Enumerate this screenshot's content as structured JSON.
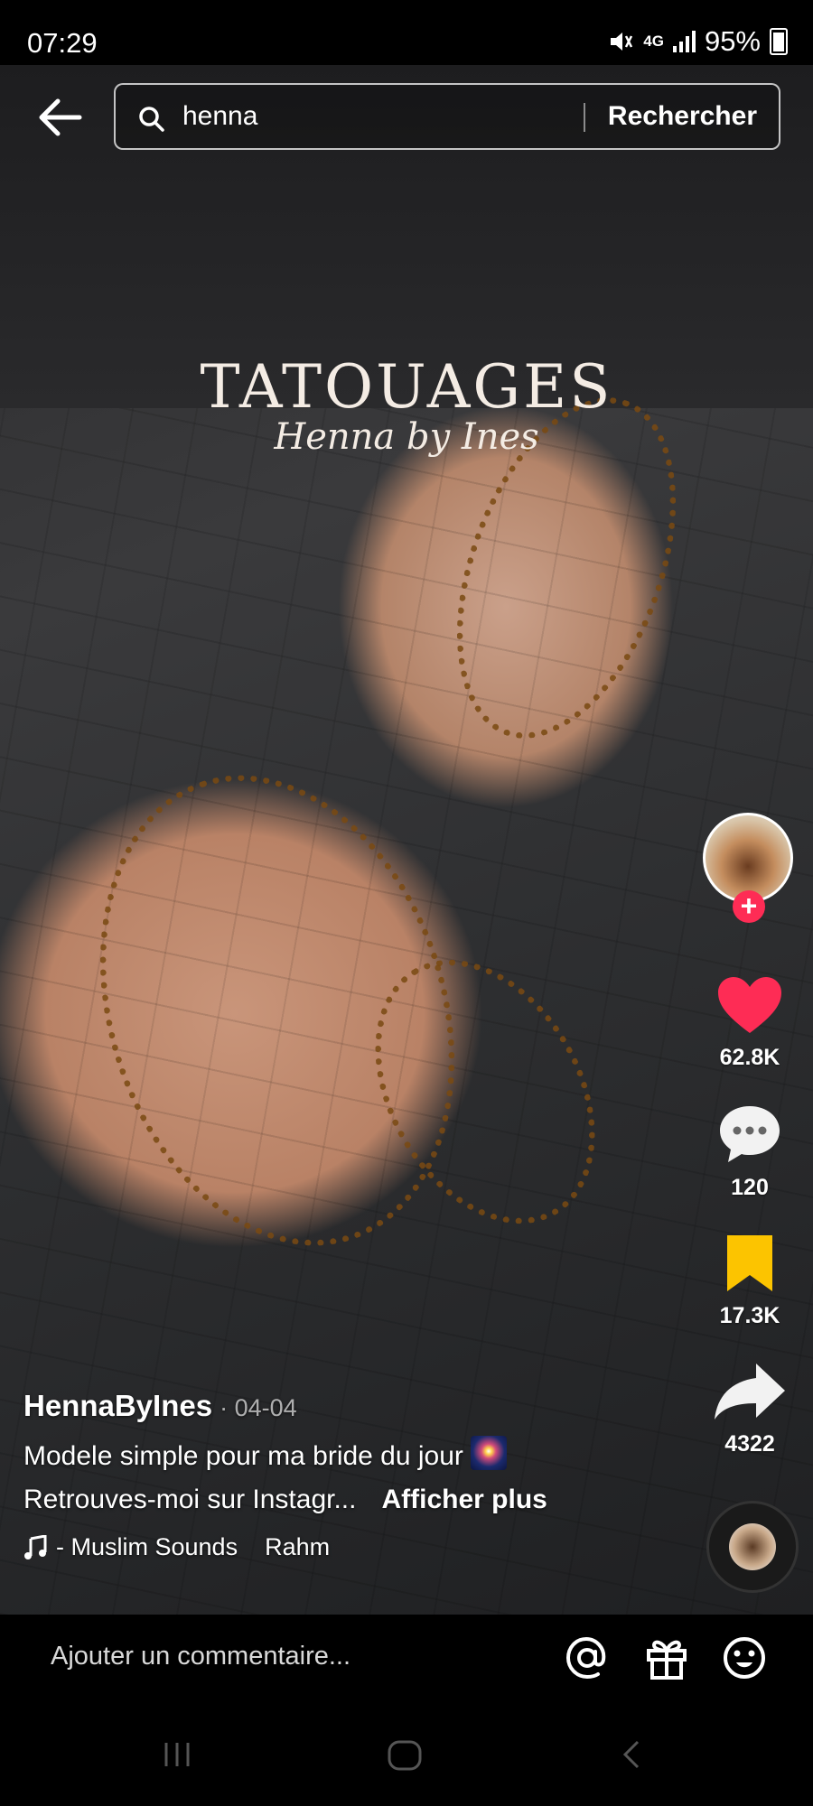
{
  "status_bar": {
    "time": "07:29",
    "network": "4G",
    "battery": "95%"
  },
  "search": {
    "query": "henna",
    "button_label": "Rechercher"
  },
  "video": {
    "watermark_title": "TATOUAGES",
    "watermark_subtitle": "Henna by Ines"
  },
  "actions": {
    "likes": "62.8K",
    "comments": "120",
    "saves": "17.3K",
    "shares": "4322",
    "like_color": "#fe2c55",
    "save_color": "#fcc400"
  },
  "post": {
    "username": "HennaByInes",
    "date": "· 04-04",
    "caption_line1": "Modele simple pour ma bride du jour",
    "caption_line2": "Retrouves-moi sur Instagr...",
    "more_label": "Afficher plus",
    "music": "- Muslim Sounds    Rahm"
  },
  "comment_bar": {
    "placeholder": "Ajouter un commentaire..."
  },
  "icons": [
    "back-arrow-icon",
    "search-icon",
    "heart-icon",
    "comment-icon",
    "bookmark-icon",
    "share-icon",
    "at-icon",
    "gift-icon",
    "emoji-icon",
    "music-note-icon"
  ]
}
